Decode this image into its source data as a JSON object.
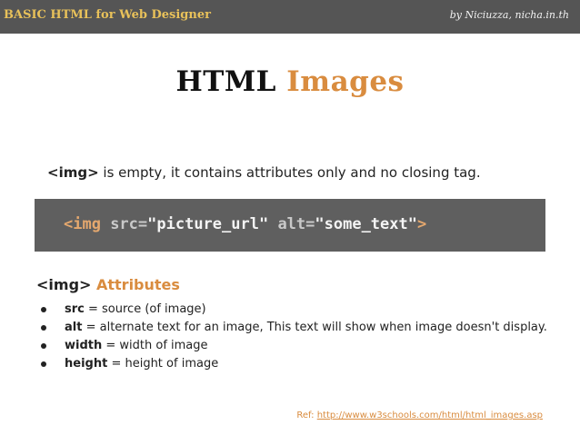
{
  "header": {
    "course": "BASIC HTML for Web Designer",
    "author": "by Niciuzza, nicha.in.th"
  },
  "title": {
    "part1": "HTML",
    "part2": "Images"
  },
  "intro": {
    "tag": "<img>",
    "text": " is empty, it contains attributes only and no closing tag."
  },
  "code": {
    "open": "<img ",
    "src_attr": "src=",
    "src_val": "\"picture_url\"",
    "alt_attr": " alt=",
    "alt_val": "\"some_text\"",
    "close": ">"
  },
  "attributes": {
    "heading_tag": "<img>",
    "heading_text": " Attributes",
    "items": [
      {
        "name": "src",
        "desc": " = source (of image)"
      },
      {
        "name": "alt",
        "desc": " = alternate text for an image, This text will show when image doesn't display."
      },
      {
        "name": "width",
        "desc": " = width of image"
      },
      {
        "name": "height",
        "desc": " = height of image"
      }
    ]
  },
  "reference": {
    "label": "Ref: ",
    "link": "http://www.w3schools.com/html/html_images.asp"
  },
  "colors": {
    "accent": "#d98c3f",
    "header_bar": "#555555",
    "code_box": "#5f5f5f",
    "course_title": "#e8c15a"
  }
}
